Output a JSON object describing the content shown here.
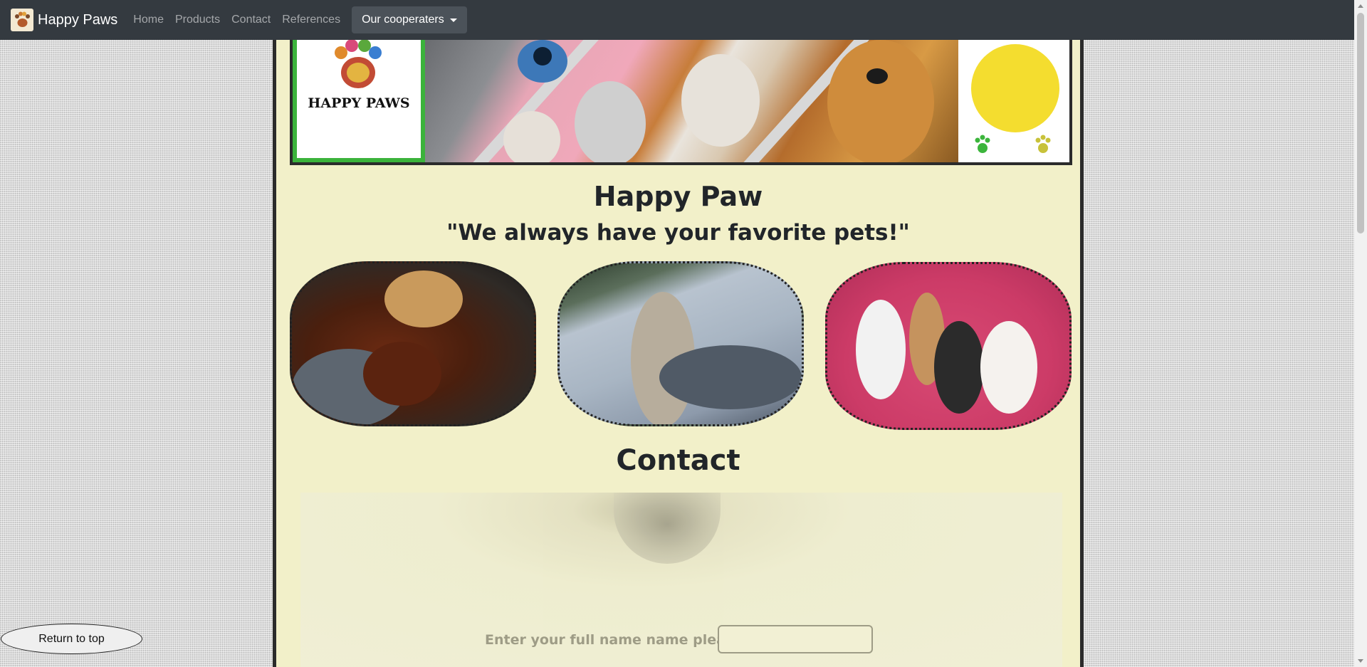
{
  "navbar": {
    "brand": "Happy Paws",
    "links": [
      "Home",
      "Products",
      "Contact",
      "References"
    ],
    "dropdown_label": "Our cooperaters"
  },
  "banner": {
    "logo_text": "HAPPY PAWS"
  },
  "hero": {
    "title": "Happy Paw",
    "tagline": "\"We always have your favorite pets!\""
  },
  "gallery": [
    "dogs-on-blanket-photo",
    "kitten-on-sofa-photo",
    "small-dogs-on-pink-photo"
  ],
  "contact": {
    "title": "Contact",
    "name_label": "Enter your full name name please:",
    "name_value": ""
  },
  "return_top": "Return to top",
  "colors": {
    "navbar_bg": "#343a40",
    "content_bg": "#f2f0c9",
    "logo_green": "#3bb33b"
  }
}
